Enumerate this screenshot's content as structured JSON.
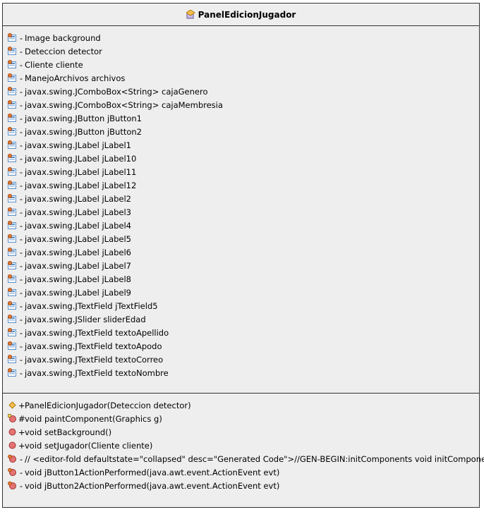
{
  "class_name": "PanelEdicionJugador",
  "attributes": [
    {
      "vis": "-",
      "text": "Image background",
      "icon": "field-icon"
    },
    {
      "vis": "-",
      "text": "Deteccion detector",
      "icon": "field-icon"
    },
    {
      "vis": "-",
      "text": "Cliente cliente",
      "icon": "field-icon"
    },
    {
      "vis": "-",
      "text": "ManejoArchivos archivos",
      "icon": "field-icon"
    },
    {
      "vis": "-",
      "text": "javax.swing.JComboBox<String> cajaGenero",
      "icon": "field-icon"
    },
    {
      "vis": "-",
      "text": "javax.swing.JComboBox<String> cajaMembresia",
      "icon": "field-icon"
    },
    {
      "vis": "-",
      "text": "javax.swing.JButton jButton1",
      "icon": "field-icon"
    },
    {
      "vis": "-",
      "text": "javax.swing.JButton jButton2",
      "icon": "field-icon"
    },
    {
      "vis": "-",
      "text": "javax.swing.JLabel jLabel1",
      "icon": "field-icon"
    },
    {
      "vis": "-",
      "text": "javax.swing.JLabel jLabel10",
      "icon": "field-icon"
    },
    {
      "vis": "-",
      "text": "javax.swing.JLabel jLabel11",
      "icon": "field-icon"
    },
    {
      "vis": "-",
      "text": "javax.swing.JLabel jLabel12",
      "icon": "field-icon"
    },
    {
      "vis": "-",
      "text": "javax.swing.JLabel jLabel2",
      "icon": "field-icon"
    },
    {
      "vis": "-",
      "text": "javax.swing.JLabel jLabel3",
      "icon": "field-icon"
    },
    {
      "vis": "-",
      "text": "javax.swing.JLabel jLabel4",
      "icon": "field-icon"
    },
    {
      "vis": "-",
      "text": "javax.swing.JLabel jLabel5",
      "icon": "field-icon"
    },
    {
      "vis": "-",
      "text": "javax.swing.JLabel jLabel6",
      "icon": "field-icon"
    },
    {
      "vis": "-",
      "text": "javax.swing.JLabel jLabel7",
      "icon": "field-icon"
    },
    {
      "vis": "-",
      "text": "javax.swing.JLabel jLabel8",
      "icon": "field-icon"
    },
    {
      "vis": "-",
      "text": "javax.swing.JLabel jLabel9",
      "icon": "field-icon"
    },
    {
      "vis": "-",
      "text": "javax.swing.JTextField jTextField5",
      "icon": "field-icon"
    },
    {
      "vis": "-",
      "text": "javax.swing.JSlider sliderEdad",
      "icon": "field-icon"
    },
    {
      "vis": "-",
      "text": "javax.swing.JTextField textoApellido",
      "icon": "field-icon"
    },
    {
      "vis": "-",
      "text": "javax.swing.JTextField textoApodo",
      "icon": "field-icon"
    },
    {
      "vis": "-",
      "text": "javax.swing.JTextField textoCorreo",
      "icon": "field-icon"
    },
    {
      "vis": "-",
      "text": "javax.swing.JTextField textoNombre",
      "icon": "field-icon"
    }
  ],
  "methods": [
    {
      "vis": "+",
      "text": "PanelEdicionJugador(Deteccion detector)",
      "icon": "constructor-icon"
    },
    {
      "vis": "#",
      "text": "void paintComponent(Graphics g)",
      "icon": "protected-method-icon"
    },
    {
      "vis": "+",
      "text": "void setBackground()",
      "icon": "public-method-icon"
    },
    {
      "vis": "+",
      "text": "void setJugador(Cliente cliente)",
      "icon": "public-method-icon"
    },
    {
      "vis": "-",
      "text": "// <editor-fold defaultstate=\"collapsed\" desc=\"Generated Code\">//GEN-BEGIN:initComponents void initComponents()",
      "icon": "private-method-icon"
    },
    {
      "vis": "-",
      "text": "void jButton1ActionPerformed(java.awt.event.ActionEvent evt)",
      "icon": "private-method-icon"
    },
    {
      "vis": "-",
      "text": "void jButton2ActionPerformed(java.awt.event.ActionEvent evt)",
      "icon": "private-method-icon"
    }
  ],
  "colors": {
    "box_bg": "#eeeeee",
    "border": "#333333",
    "field_icon_blue": "#5a8fc8",
    "field_icon_orange": "#e07a30",
    "method_icon_red": "#e57373",
    "constructor_icon_yellow": "#f5c04a"
  }
}
